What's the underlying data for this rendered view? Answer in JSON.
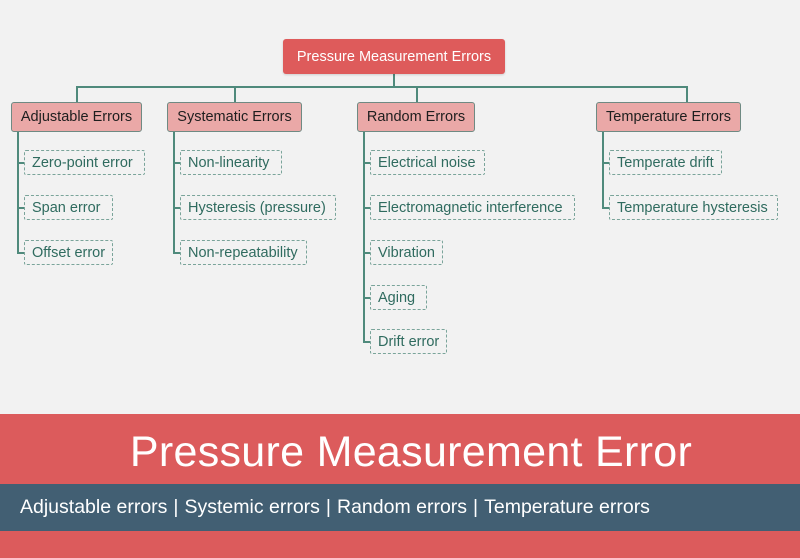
{
  "diagram": {
    "root": {
      "label": "Pressure Measurement Errors"
    },
    "categories": [
      {
        "label": "Adjustable Errors",
        "items": [
          "Zero-point error",
          "Span error",
          "Offset error"
        ]
      },
      {
        "label": "Systematic Errors",
        "items": [
          "Non-linearity",
          "Hysteresis (pressure)",
          "Non-repeatability"
        ]
      },
      {
        "label": "Random Errors",
        "items": [
          "Electrical noise",
          "Electromagnetic interference",
          "Vibration",
          "Aging",
          "Drift error"
        ]
      },
      {
        "label": "Temperature Errors",
        "items": [
          "Temperate drift",
          "Temperature hysteresis"
        ]
      }
    ]
  },
  "banner": {
    "title": "Pressure Measurement Error",
    "subtitle_items": [
      "Adjustable errors",
      "Systemic errors",
      "Random errors",
      "Temperature errors"
    ],
    "separator": "|"
  },
  "colors": {
    "root_fill": "#de5b5b",
    "category_fill": "#eaa8a7",
    "connector": "#4f8a7c",
    "leaf_text": "#2f6b5f",
    "banner_red": "#dc5b5c",
    "banner_band": "#425f73",
    "background": "#f2f2f2"
  }
}
